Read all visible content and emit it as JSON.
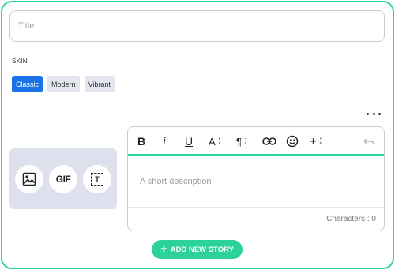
{
  "title_field": {
    "placeholder": "Title",
    "value": ""
  },
  "skin": {
    "label": "SKIN",
    "options": [
      {
        "label": "Classic",
        "active": true
      },
      {
        "label": "Modern",
        "active": false
      },
      {
        "label": "Vibrant",
        "active": false
      }
    ]
  },
  "media": {
    "buttons": [
      {
        "icon": "image-icon"
      },
      {
        "icon": "gif-icon",
        "label": "GIF"
      },
      {
        "icon": "text-box-icon",
        "label": "T"
      }
    ]
  },
  "editor": {
    "toolbar": {
      "bold": "B",
      "italic": "i",
      "underline": "U",
      "font_size": "A",
      "paragraph": "¶",
      "link": "link-icon",
      "emoji": "emoji-icon",
      "insert": "+",
      "undo": "undo-icon"
    },
    "description_placeholder": "A short description",
    "counter_text": "Characters : 0"
  },
  "add_story_label": "ADD NEW STORY",
  "colors": {
    "accent": "#2bd39a",
    "primary": "#1a73e8",
    "media_bg": "#dde1ee"
  }
}
